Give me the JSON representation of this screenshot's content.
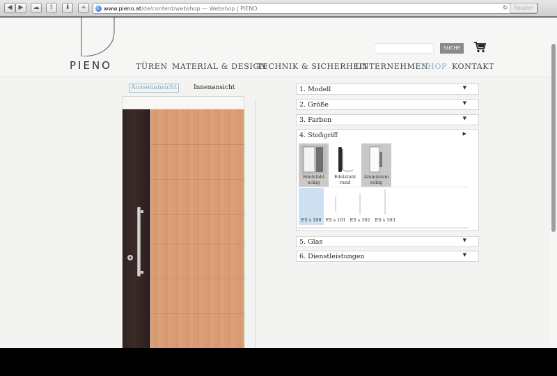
{
  "browser": {
    "url_host": "www.pieno.at",
    "url_path": "/de/content/webshop",
    "url_title": " — Webshop | PIENO",
    "reader_label": "Reader"
  },
  "header": {
    "logo": "PIENO",
    "search_button": "SUCHE",
    "nav": [
      "TÜREN",
      "MATERIAL & DESIGN",
      "TECHNIK & SICHERHEIT",
      "UNTERNEHMEN",
      "SHOP",
      "KONTAKT"
    ],
    "active_nav": "SHOP"
  },
  "views": {
    "outside": "Aussenansicht",
    "inside": "Innenansicht"
  },
  "config": {
    "sections": [
      {
        "label": "1. Modell",
        "state": "collapsed"
      },
      {
        "label": "2. Größe",
        "state": "collapsed"
      },
      {
        "label": "3. Farben",
        "state": "collapsed"
      },
      {
        "label": "4. Stoßgriff",
        "state": "expanded"
      },
      {
        "label": "5. Glas",
        "state": "collapsed"
      },
      {
        "label": "6. Dienstleistungen",
        "state": "collapsed"
      }
    ],
    "handle_types": [
      {
        "line1": "Edelstahl",
        "line2": "eckig",
        "selected": true
      },
      {
        "line1": "Edelstahl",
        "line2": "rund",
        "selected": false
      },
      {
        "line1": "Aluminium",
        "line2": "eckig",
        "selected": true
      }
    ],
    "handle_variants": [
      {
        "label": "ES s 100",
        "selected": true
      },
      {
        "label": "ES s 101",
        "selected": false
      },
      {
        "label": "ES s 102",
        "selected": false
      },
      {
        "label": "ES s 103",
        "selected": false
      }
    ]
  },
  "icons": {
    "cart": "cart-icon",
    "reload": "reload-icon",
    "favicon": "globe-icon"
  },
  "colors": {
    "accent": "#8ab6d6",
    "wood": "#d99c73",
    "dark_panel": "#33251f"
  }
}
